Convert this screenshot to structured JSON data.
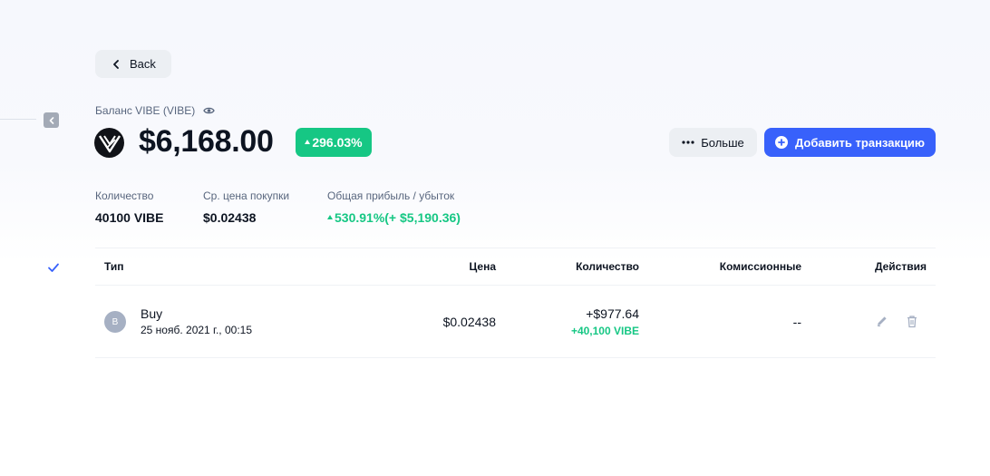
{
  "nav": {
    "back_label": "Back"
  },
  "header": {
    "balance_label": "Баланс VIBE (VIBE)",
    "balance_value": "$6,168.00",
    "change_pct": "296.03%",
    "more_label": "Больше",
    "add_transaction_label": "Добавить транзакцию"
  },
  "stats": {
    "quantity_label": "Количество",
    "quantity_value": "40100 VIBE",
    "avg_price_label": "Ср. цена покупки",
    "avg_price_value": "$0.02438",
    "pnl_label": "Общая прибыль / убыток",
    "pnl_value": "530.91%(+ $5,190.36)"
  },
  "table": {
    "headers": {
      "type": "Тип",
      "price": "Цена",
      "quantity": "Количество",
      "fees": "Комиссионные",
      "actions": "Действия"
    },
    "rows": [
      {
        "avatar_letter": "B",
        "type": "Buy",
        "date": "25 нояб. 2021 г., 00:15",
        "price": "$0.02438",
        "amount_usd": "+$977.64",
        "amount_coin": "+40,100 VIBE",
        "fees": "--"
      }
    ]
  },
  "colors": {
    "accent": "#3861fb",
    "positive": "#16c784",
    "button_gray": "#eceff3",
    "text_muted": "#58667e"
  },
  "icons": [
    "chevron-left-icon",
    "eye-icon",
    "vibe-logo-icon",
    "more-dots-icon",
    "plus-circle-icon",
    "pencil-icon",
    "trash-icon",
    "checkmark-icon",
    "collapse-icon"
  ]
}
